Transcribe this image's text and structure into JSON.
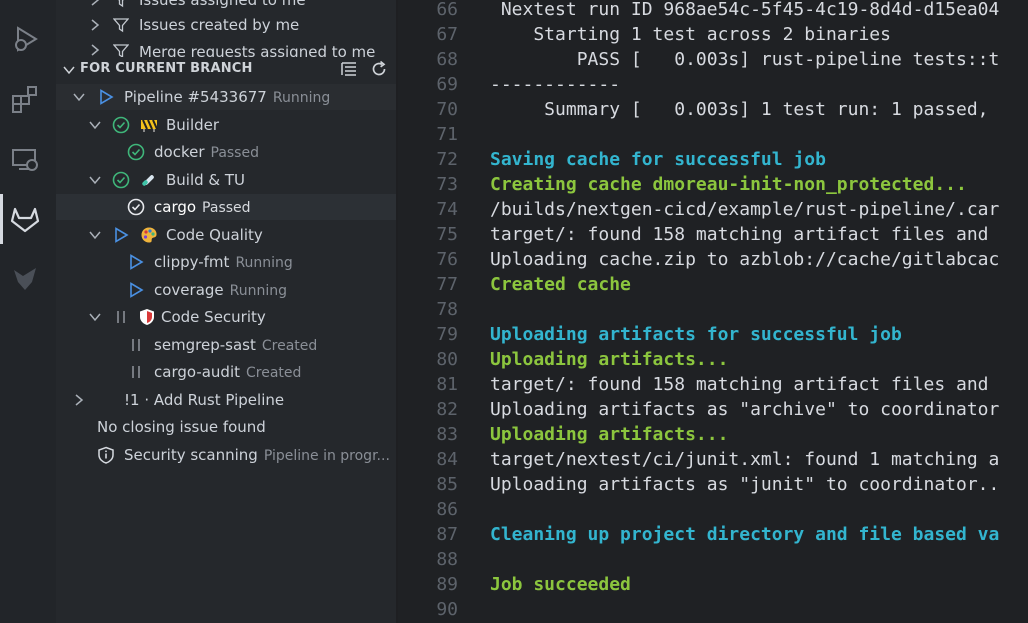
{
  "sidebar": {
    "top_items": [
      {
        "label": "Issues assigned to me"
      },
      {
        "label": "Issues created by me"
      },
      {
        "label": "Merge requests assigned to me"
      }
    ],
    "section_title": "FOR CURRENT BRANCH",
    "pipeline": {
      "label": "Pipeline #5433677",
      "status": "Running"
    },
    "stages": [
      {
        "name": "Builder",
        "icon": "construction-sign-icon",
        "status": "passed",
        "jobs": [
          {
            "name": "docker",
            "status": "Passed"
          }
        ]
      },
      {
        "name": "Build & TU",
        "icon": "test-tube-icon",
        "status": "passed",
        "jobs": [
          {
            "name": "cargo",
            "status": "Passed"
          }
        ]
      },
      {
        "name": "Code Quality",
        "icon": "artist-palette-icon",
        "status": "running",
        "jobs": [
          {
            "name": "clippy-fmt",
            "status": "Running"
          },
          {
            "name": "coverage",
            "status": "Running"
          }
        ]
      },
      {
        "name": "Code Security",
        "icon": "shield-icon",
        "status": "created",
        "jobs": [
          {
            "name": "semgrep-sast",
            "status": "Created"
          },
          {
            "name": "cargo-audit",
            "status": "Created"
          }
        ]
      }
    ],
    "merge_request": "!1 · Add Rust Pipeline",
    "closing_issue": "No closing issue found",
    "security": {
      "label": "Security scanning",
      "status": "Pipeline in progr..."
    }
  },
  "log": [
    {
      "n": "66",
      "text": " Nextest run ID 968ae54c-5f45-4c19-8d4d-d15ea04",
      "style": "normal"
    },
    {
      "n": "67",
      "text": "    Starting 1 test across 2 binaries",
      "style": "normal"
    },
    {
      "n": "68",
      "text": "        PASS [   0.003s] rust-pipeline tests::t",
      "style": "normal"
    },
    {
      "n": "69",
      "text": "------------",
      "style": "normal"
    },
    {
      "n": "70",
      "text": "     Summary [   0.003s] 1 test run: 1 passed,",
      "style": "normal"
    },
    {
      "n": "71",
      "text": "",
      "style": "normal"
    },
    {
      "n": "72",
      "text": "Saving cache for successful job",
      "style": "cyan"
    },
    {
      "n": "73",
      "text": "Creating cache dmoreau-init-non_protected...",
      "style": "green"
    },
    {
      "n": "74",
      "text": "/builds/nextgen-cicd/example/rust-pipeline/.car",
      "style": "normal"
    },
    {
      "n": "75",
      "text": "target/: found 158 matching artifact files and",
      "style": "normal"
    },
    {
      "n": "76",
      "text": "Uploading cache.zip to azblob://cache/gitlabcac",
      "style": "normal"
    },
    {
      "n": "77",
      "text": "Created cache",
      "style": "green"
    },
    {
      "n": "78",
      "text": "",
      "style": "normal"
    },
    {
      "n": "79",
      "text": "Uploading artifacts for successful job",
      "style": "cyan"
    },
    {
      "n": "80",
      "text": "Uploading artifacts...",
      "style": "green"
    },
    {
      "n": "81",
      "text": "target/: found 158 matching artifact files and",
      "style": "normal"
    },
    {
      "n": "82",
      "text": "Uploading artifacts as \"archive\" to coordinator",
      "style": "normal"
    },
    {
      "n": "83",
      "text": "Uploading artifacts...",
      "style": "green"
    },
    {
      "n": "84",
      "text": "target/nextest/ci/junit.xml: found 1 matching a",
      "style": "normal"
    },
    {
      "n": "85",
      "text": "Uploading artifacts as \"junit\" to coordinator..",
      "style": "normal"
    },
    {
      "n": "86",
      "text": "",
      "style": "normal"
    },
    {
      "n": "87",
      "text": "Cleaning up project directory and file based va",
      "style": "cyan"
    },
    {
      "n": "88",
      "text": "",
      "style": "normal"
    },
    {
      "n": "89",
      "text": "Job succeeded",
      "style": "green"
    },
    {
      "n": "90",
      "text": "",
      "style": "normal"
    }
  ],
  "colors": {
    "passed": "#3fb67a",
    "running": "#4a90e2",
    "created": "#8a8f97",
    "log_cyan": "#33b5cf",
    "log_green": "#8cc63e"
  }
}
